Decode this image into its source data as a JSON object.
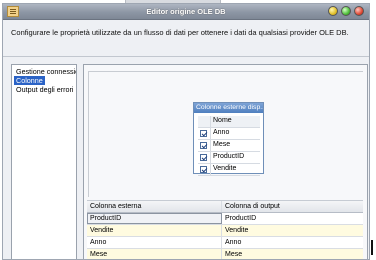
{
  "window": {
    "title": "Editor origine OLE DB",
    "description": "Configurare le proprietà utilizzate da un flusso di dati per ottenere i dati da qualsiasi provider OLE DB."
  },
  "nav": {
    "items": [
      {
        "label": "Gestione connessione"
      },
      {
        "label": "Colonne"
      },
      {
        "label": "Output degli errori"
      }
    ],
    "selected": "Colonne"
  },
  "popup": {
    "title": "Colonne esterne disp...",
    "header": "Nome",
    "items": [
      {
        "label": "Anno",
        "checked": true
      },
      {
        "label": "Mese",
        "checked": true
      },
      {
        "label": "ProductID",
        "checked": true
      },
      {
        "label": "Vendite",
        "checked": true
      }
    ]
  },
  "grid": {
    "columns": [
      "Colonna esterna",
      "Colonna di output"
    ],
    "rows": [
      [
        "ProductID",
        "ProductID"
      ],
      [
        "Vendite",
        "Vendite"
      ],
      [
        "Anno",
        "Anno"
      ],
      [
        "Mese",
        "Mese"
      ]
    ]
  }
}
